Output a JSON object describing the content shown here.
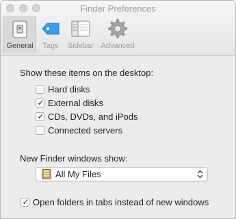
{
  "window": {
    "title": "Finder Preferences"
  },
  "toolbar": {
    "tabs": [
      {
        "label": "General",
        "icon": "general-icon",
        "selected": true
      },
      {
        "label": "Tags",
        "icon": "tag-icon",
        "selected": false
      },
      {
        "label": "Sidebar",
        "icon": "sidebar-icon",
        "selected": false
      },
      {
        "label": "Advanced",
        "icon": "gear-icon",
        "selected": false
      }
    ]
  },
  "desktop": {
    "heading": "Show these items on the desktop:",
    "items": [
      {
        "label": "Hard disks",
        "checked": false
      },
      {
        "label": "External disks",
        "checked": true
      },
      {
        "label": "CDs, DVDs, and iPods",
        "checked": true
      },
      {
        "label": "Connected servers",
        "checked": false
      }
    ]
  },
  "new_window": {
    "label": "New Finder windows show:",
    "selected": "All My Files",
    "icon": "all-my-files-icon"
  },
  "tabs_option": {
    "label": "Open folders in tabs instead of new windows",
    "checked": true
  },
  "colors": {
    "window_bg": "#ececec",
    "selected_tab_bg": "#d9d9d9",
    "tag_blue": "#3c9be8",
    "check_mark": "#222222"
  },
  "glyphs": {
    "check": "✓"
  }
}
